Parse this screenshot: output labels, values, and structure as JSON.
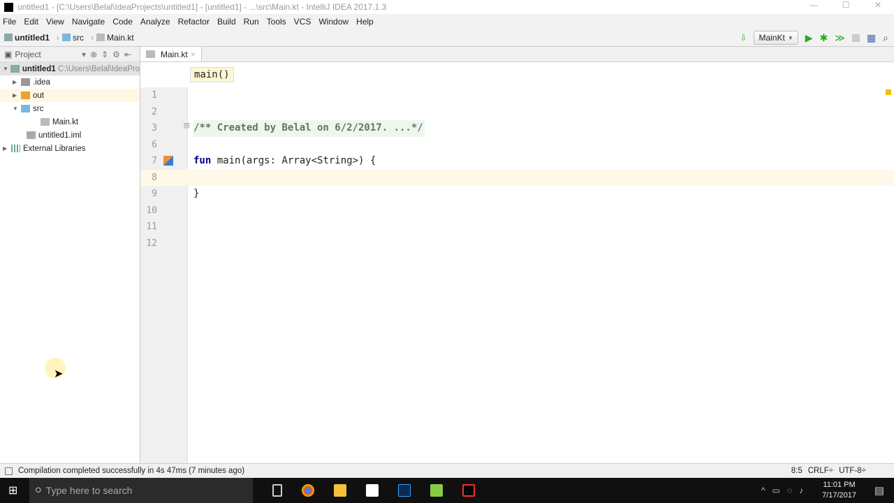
{
  "window": {
    "title": "untitled1 - [C:\\Users\\Belal\\IdeaProjects\\untitled1] - [untitled1] - ...\\src\\Main.kt - IntelliJ IDEA 2017.1.3",
    "controls": [
      "—",
      "☐",
      "✕"
    ]
  },
  "menu": [
    "File",
    "Edit",
    "View",
    "Navigate",
    "Code",
    "Analyze",
    "Refactor",
    "Build",
    "Run",
    "Tools",
    "VCS",
    "Window",
    "Help"
  ],
  "breadcrumb": [
    "untitled1",
    "src",
    "Main.kt"
  ],
  "run_config": "MainKt",
  "project_panel": {
    "title": "Project",
    "root": "untitled1",
    "root_path": "C:\\Users\\Belal\\IdeaPro",
    "items": [
      ".idea",
      "out",
      "src",
      "Main.kt",
      "untitled1.iml",
      "External Libraries"
    ]
  },
  "editor": {
    "tab": "Main.kt",
    "structure_hint": "main()",
    "lines": [
      {
        "n": "1",
        "code": ""
      },
      {
        "n": "2",
        "code": ""
      },
      {
        "n": "3",
        "code": "/** Created by Belal on 6/2/2017. ...*/"
      },
      {
        "n": "6",
        "code": ""
      },
      {
        "n": "7",
        "kw": "fun",
        "code": " main(args: Array<String>) {"
      },
      {
        "n": "8",
        "code": ""
      },
      {
        "n": "9",
        "code": "}"
      },
      {
        "n": "10",
        "code": ""
      },
      {
        "n": "11",
        "code": ""
      },
      {
        "n": "12",
        "code": ""
      }
    ]
  },
  "status": {
    "message": "Compilation completed successfully in 4s 47ms (7 minutes ago)",
    "position": "8:5",
    "line_sep": "CRLF÷",
    "encoding": "UTF-8÷"
  },
  "taskbar": {
    "search_placeholder": "Type here to search",
    "time": "11:01 PM",
    "date": "7/17/2017"
  }
}
